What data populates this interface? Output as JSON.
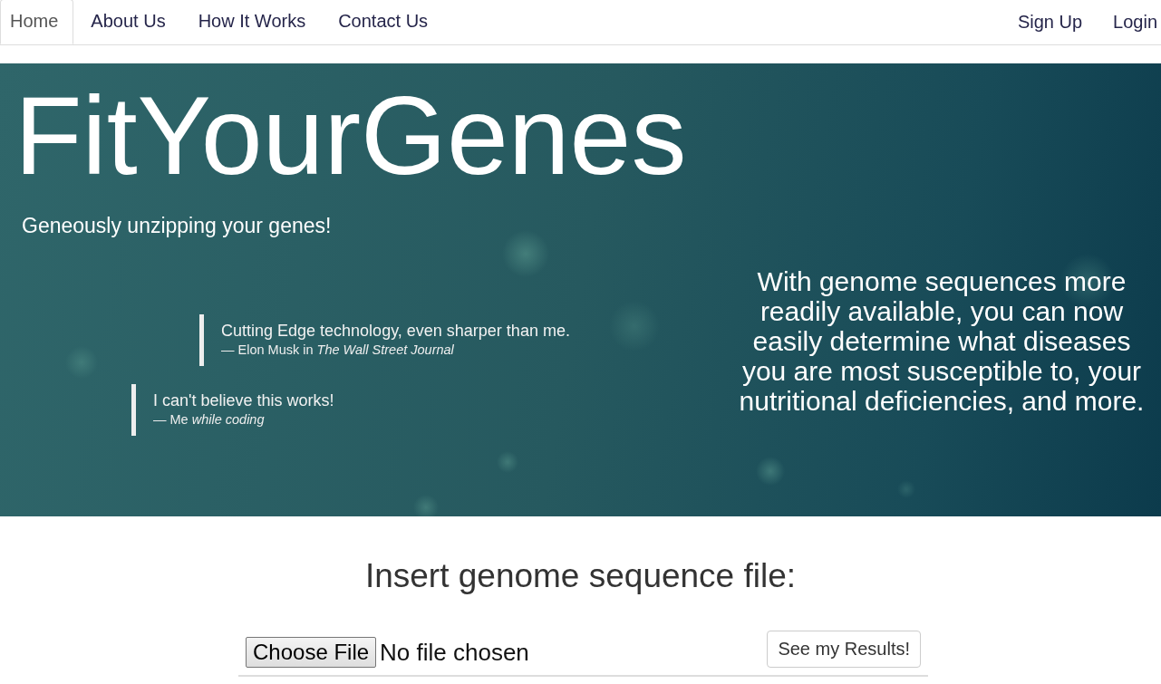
{
  "nav": {
    "tabs": [
      {
        "label": "Home",
        "selected": true
      },
      {
        "label": "About Us",
        "selected": false
      },
      {
        "label": "How It Works",
        "selected": false
      },
      {
        "label": "Contact Us",
        "selected": false
      }
    ],
    "account_links": [
      "Sign Up",
      "Login"
    ]
  },
  "hero": {
    "title": "FitYourGenes",
    "tagline": "Geneously unzipping your genes!",
    "quotes": [
      {
        "text": "Cutting Edge technology, even sharper than me.",
        "attribution": "— Elon Musk in *The Wall Street Journal*"
      },
      {
        "text": "I can't believe this works!",
        "attribution": "— Me *while coding*"
      }
    ],
    "description": "With genome sequences more readily available, you can now easily determine what diseases you are most susceptible to, your nutritional deficiencies, and more."
  },
  "upload": {
    "heading": "Insert genome sequence file:",
    "file_button": "Choose File",
    "file_status": "No file chosen",
    "submit_button": "See my Results!"
  }
}
